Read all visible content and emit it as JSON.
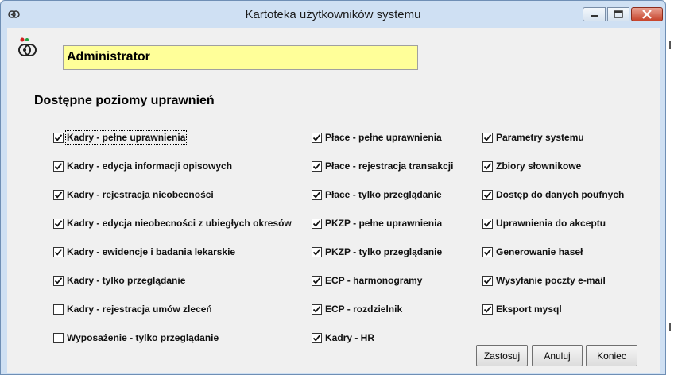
{
  "window": {
    "title": "Kartoteka użytkowników systemu"
  },
  "user": {
    "name": "Administrator"
  },
  "section": {
    "title": "Dostępne poziomy uprawnień"
  },
  "columns": [
    [
      {
        "label": "Kadry - pełne uprawnienia",
        "checked": true
      },
      {
        "label": "Kadry - edycja informacji opisowych",
        "checked": true
      },
      {
        "label": "Kadry - rejestracja nieobecności",
        "checked": true
      },
      {
        "label": "Kadry - edycja nieobecności z ubiegłych okresów",
        "checked": true
      },
      {
        "label": "Kadry - ewidencje i badania lekarskie",
        "checked": true
      },
      {
        "label": "Kadry - tylko przeglądanie",
        "checked": true
      },
      {
        "label": "Kadry - rejestracja umów zleceń",
        "checked": false
      },
      {
        "label": "Wyposażenie - tylko przeglądanie",
        "checked": false
      }
    ],
    [
      {
        "label": "Płace - pełne uprawnienia",
        "checked": true
      },
      {
        "label": "Płace - rejestracja transakcji",
        "checked": true
      },
      {
        "label": "Płace - tylko przeglądanie",
        "checked": true
      },
      {
        "label": "PKZP - pełne uprawnienia",
        "checked": true
      },
      {
        "label": "PKZP - tylko przeglądanie",
        "checked": true
      },
      {
        "label": "ECP - harmonogramy",
        "checked": true
      },
      {
        "label": "ECP - rozdzielnik",
        "checked": true
      },
      {
        "label": "Kadry - HR",
        "checked": true
      }
    ],
    [
      {
        "label": "Parametry systemu",
        "checked": true
      },
      {
        "label": "Zbiory słownikowe",
        "checked": true
      },
      {
        "label": "Dostęp do danych poufnych",
        "checked": true
      },
      {
        "label": "Uprawnienia do akceptu",
        "checked": true
      },
      {
        "label": "Generowanie haseł",
        "checked": true
      },
      {
        "label": "Wysyłanie poczty e-mail",
        "checked": true
      },
      {
        "label": "Eksport mysql",
        "checked": true
      }
    ]
  ],
  "buttons": {
    "apply": "Zastosuj",
    "cancel": "Anuluj",
    "close": "Koniec"
  },
  "icons": {
    "app": "key-icon",
    "user": "user-key-icon"
  }
}
